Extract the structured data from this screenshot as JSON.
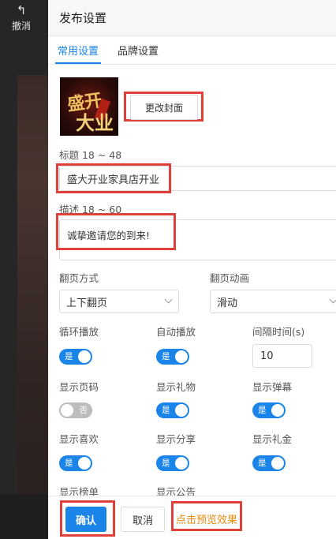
{
  "leftbar": {
    "undo_label": "撤消",
    "undo_icon": "undo-arrow-icon"
  },
  "panel": {
    "title": "发布设置"
  },
  "tabs": [
    {
      "label": "常用设置",
      "active": true
    },
    {
      "label": "品牌设置",
      "active": false
    }
  ],
  "cover": {
    "change_button": "更改封面",
    "image_text_top": "盛开大业"
  },
  "title_field": {
    "label": "标题 18 ~ 48",
    "value": "盛大开业家具店开业"
  },
  "desc_field": {
    "label": "描述 18 ~ 60",
    "value": "诚挚邀请您的到来!"
  },
  "page_turn": {
    "label": "翻页方式",
    "value": "上下翻页"
  },
  "page_anim": {
    "label": "翻页动画",
    "value": "滑动"
  },
  "loop_play": {
    "label": "循环播放",
    "toggle": "是",
    "on": true
  },
  "auto_play": {
    "label": "自动播放",
    "toggle": "是",
    "on": true
  },
  "interval": {
    "label": "间隔时间(s)",
    "value": "10"
  },
  "show_page_num": {
    "label": "显示页码",
    "toggle": "否",
    "on": false
  },
  "show_gift": {
    "label": "显示礼物",
    "toggle": "是",
    "on": true
  },
  "show_danmaku": {
    "label": "显示弹幕",
    "toggle": "是",
    "on": true
  },
  "show_like": {
    "label": "显示喜欢",
    "toggle": "是",
    "on": true
  },
  "show_share": {
    "label": "显示分享",
    "toggle": "是",
    "on": true
  },
  "show_giftmoney": {
    "label": "显示礼金",
    "toggle": "是",
    "on": true
  },
  "show_rank": {
    "label": "显示榜单"
  },
  "show_notice": {
    "label": "显示公告"
  },
  "footer": {
    "confirm": "确认",
    "cancel": "取消",
    "preview": "点击预览效果"
  },
  "colors": {
    "accent": "#1a84e8",
    "highlight": "#e0403a",
    "preview": "#e98a0a"
  }
}
